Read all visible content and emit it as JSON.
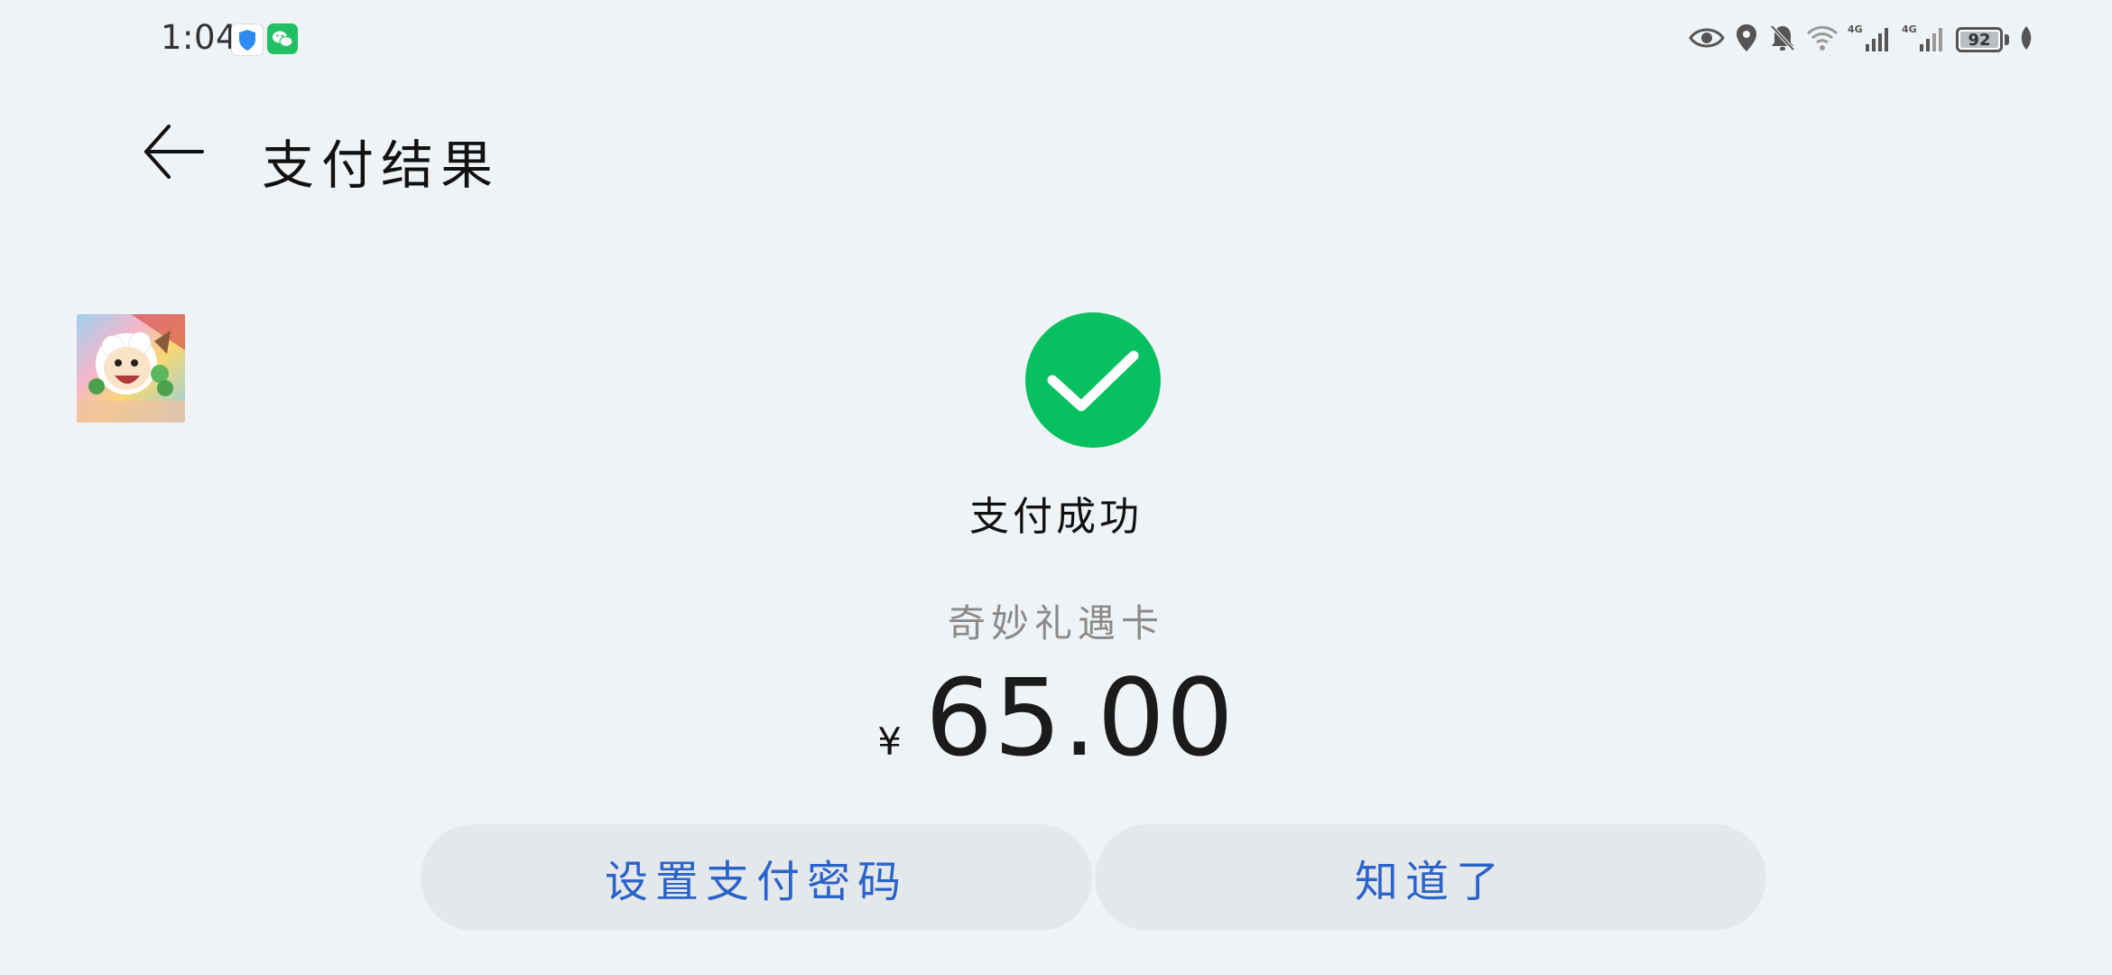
{
  "status_bar": {
    "time": "1:04",
    "battery": "92",
    "network_1": "4G",
    "network_2": "4G"
  },
  "header": {
    "title": "支付结果"
  },
  "result": {
    "status_text": "支付成功",
    "merchant": "奇妙礼遇卡",
    "currency": "¥",
    "amount": "65.00"
  },
  "actions": {
    "set_password_label": "设置支付密码",
    "got_it_label": "知道了"
  },
  "colors": {
    "success_green": "#07c160",
    "button_text_blue": "#2a63c9",
    "background": "#eff3f6"
  },
  "icons": {
    "back": "arrow-left-icon",
    "success": "checkmark-icon",
    "eye": "eye-icon",
    "location": "location-pin-icon",
    "mute": "bell-off-icon",
    "wifi": "wifi-icon"
  }
}
